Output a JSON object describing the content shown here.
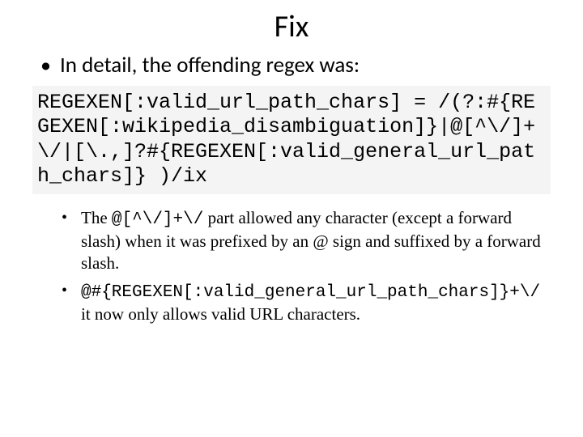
{
  "title": "Fix",
  "bullet1": "In detail, the offending regex was:",
  "code": "REGEXEN[:valid_url_path_chars] = /(?:#{REGEXEN[:wikipedia_disambiguation]}|@[^\\/]+\\/|[\\.,]?#{REGEXEN[:valid_general_url_path_chars]} )/ix",
  "sub1_a": "The ",
  "sub1_code": "@[^\\/]+\\/",
  "sub1_b": " part allowed any character (except a forward slash) when it was prefixed by an @ sign and suffixed by a forward slash.",
  "sub2_code": "@#{REGEXEN[:valid_general_url_path_chars]}+\\/",
  "sub2_b": " it now only allows valid URL characters."
}
